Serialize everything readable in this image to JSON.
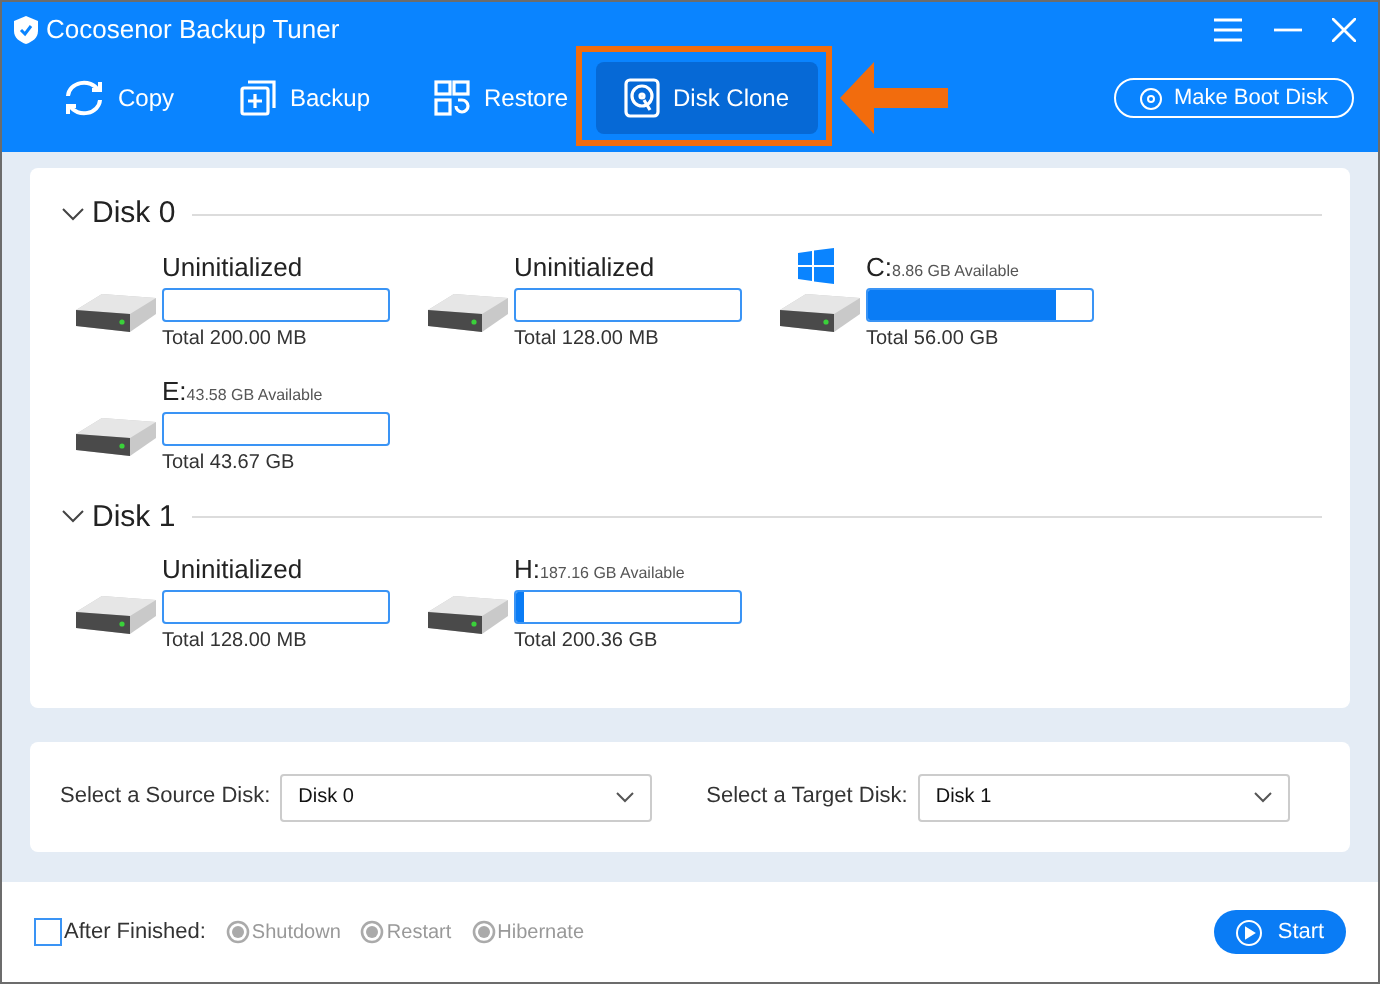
{
  "window": {
    "title": "Cocosenor Backup Tuner"
  },
  "toolbar": [
    {
      "label": "Copy",
      "kind": "copy",
      "selected": false
    },
    {
      "label": "Backup",
      "kind": "backup",
      "selected": false
    },
    {
      "label": "Restore",
      "kind": "restore",
      "selected": false
    },
    {
      "label": "Disk Clone",
      "kind": "clone",
      "selected": true
    }
  ],
  "boot_button": "Make Boot Disk",
  "disks": [
    {
      "name": "Disk 0",
      "expanded": true,
      "partitions": [
        {
          "name": "Uninitialized",
          "total": "Total 200.00 MB",
          "system": false
        },
        {
          "name": "Uninitialized",
          "total": "Total 128.00 MB",
          "system": false
        },
        {
          "name": "C:",
          "available": "8.86 GB Available",
          "level": 0.84,
          "total": "Total 56.00 GB",
          "system": true
        },
        {
          "name": "E:",
          "available": "43.58 GB Available",
          "total": "Total 43.67 GB",
          "system": false
        }
      ]
    },
    {
      "name": "Disk 1",
      "expanded": true,
      "partitions": [
        {
          "name": "Uninitialized",
          "total": "Total 128.00 MB",
          "system": false
        },
        {
          "name": "H:",
          "available": "187.16 GB Available",
          "level": 0.04,
          "total": "Total 200.36 GB",
          "system": false
        }
      ]
    }
  ],
  "source": {
    "label": "Select a Source Disk:",
    "value": "Disk 0"
  },
  "target": {
    "label": "Select a Target Disk:",
    "value": "Disk 1"
  },
  "after_finished": {
    "label": "After Finished:",
    "checked": false,
    "options": [
      {
        "label": "Shutdown",
        "disabled": true
      },
      {
        "label": "Restart",
        "disabled": true
      },
      {
        "label": "Hibernate",
        "disabled": true
      }
    ]
  },
  "start_button": "Start"
}
